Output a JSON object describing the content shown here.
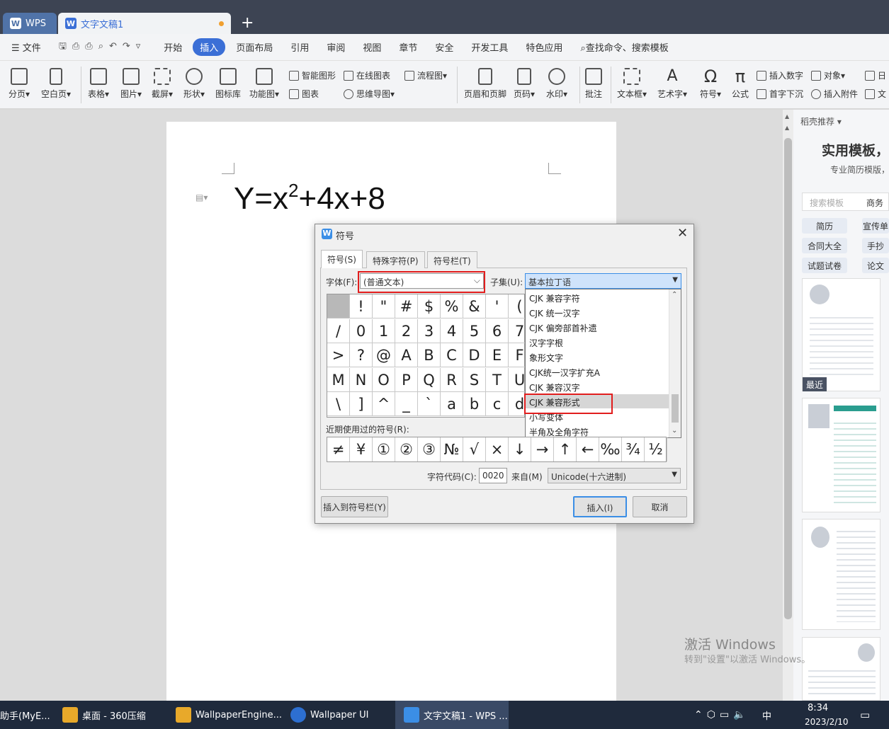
{
  "tabs": {
    "wps": "WPS",
    "document": "文字文稿1",
    "new_tab": "+"
  },
  "menu": {
    "file": "文件",
    "items": [
      "开始",
      "插入",
      "页面布局",
      "引用",
      "审阅",
      "视图",
      "章节",
      "安全",
      "开发工具",
      "特色应用"
    ],
    "active": "插入",
    "search": "查找命令、搜索模板"
  },
  "ribbon": {
    "page_break": "分页",
    "blank_page": "空白页",
    "table": "表格",
    "picture": "图片",
    "screenshot": "截屏",
    "shape": "形状",
    "icon_lib": "图标库",
    "func_chart": "功能图",
    "smart_shape": "智能图形",
    "online_chart": "在线图表",
    "flowchart": "流程图",
    "chart": "图表",
    "mindmap": "思维导图",
    "header_footer": "页眉和页脚",
    "page_num": "页码",
    "watermark": "水印",
    "comment": "批注",
    "textbox": "文本框",
    "art_text": "艺术字",
    "symbol": "符号",
    "formula": "公式",
    "insert_number": "插入数字",
    "object": "对象",
    "drop_cap": "首字下沉",
    "attachment": "插入附件",
    "date_partial": "日",
    "text_partial": "文"
  },
  "document": {
    "equation_base": "Y=x",
    "equation_sup": "2",
    "equation_rest": "+4x+8"
  },
  "dialog": {
    "title": "符号",
    "tabs": [
      "符号(S)",
      "特殊字符(P)",
      "符号栏(T)"
    ],
    "font_label": "字体(F):",
    "font_value": "(普通文本)",
    "subset_label": "子集(U):",
    "subset_value": "基本拉丁语",
    "grid_rows": [
      [
        "",
        "!",
        "\"",
        "#",
        "$",
        "%",
        "&",
        "'",
        "("
      ],
      [
        "/",
        "0",
        "1",
        "2",
        "3",
        "4",
        "5",
        "6",
        "7"
      ],
      [
        ">",
        "?",
        "@",
        "A",
        "B",
        "C",
        "D",
        "E",
        "F"
      ],
      [
        "M",
        "N",
        "O",
        "P",
        "Q",
        "R",
        "S",
        "T",
        "U"
      ],
      [
        "\\",
        "]",
        "^",
        "_",
        "`",
        "a",
        "b",
        "c",
        "d"
      ]
    ],
    "subset_options": [
      "CJK 兼容字符",
      "CJK 统一汉字",
      "CJK 偏旁部首补遗",
      "汉字字根",
      "象形文字",
      "CJK统一汉字扩充A",
      "CJK 兼容汉字",
      "CJK 兼容形式",
      "小写变体",
      "半角及全角字符"
    ],
    "highlighted_option": "CJK 兼容形式",
    "recent_label": "近期使用过的符号(R):",
    "recent_symbols": [
      "≠",
      "¥",
      "①",
      "②",
      "③",
      "№",
      "√",
      "×",
      "↓",
      "→",
      "↑",
      "←",
      "‰",
      "¾",
      "½"
    ],
    "code_label": "字符代码(C):",
    "code_value": "0020",
    "from_label": "来自(M)",
    "from_value": "Unicode(十六进制)",
    "insert_to_bar": "插入到符号栏(Y)",
    "insert": "插入(I)",
    "cancel": "取消"
  },
  "right_panel": {
    "header": "稻壳推荐",
    "title": "实用模板，",
    "subtitle": "专业简历模版，",
    "search_placeholder": "搜索模板",
    "search_tag": "商务",
    "tags": [
      "简历",
      "宣传单",
      "合同大全",
      "手抄",
      "试题试卷",
      "论文"
    ],
    "recent_badge": "最近"
  },
  "watermark": {
    "line1": "激活 Windows",
    "line2": "转到\"设置\"以激活 Windows。"
  },
  "taskbar": {
    "items": [
      "助手(MyE...",
      "桌面 - 360压缩",
      "WallpaperEngine...",
      "Wallpaper UI",
      "文字文稿1 - WPS ..."
    ],
    "time": "8:34",
    "date": "2023/2/10",
    "ime": "中"
  },
  "colors": {
    "accent": "#3b6fd6",
    "highlight": "#e11d1d",
    "titlebar": "#3d4453",
    "taskbar": "#1f2a3c"
  }
}
